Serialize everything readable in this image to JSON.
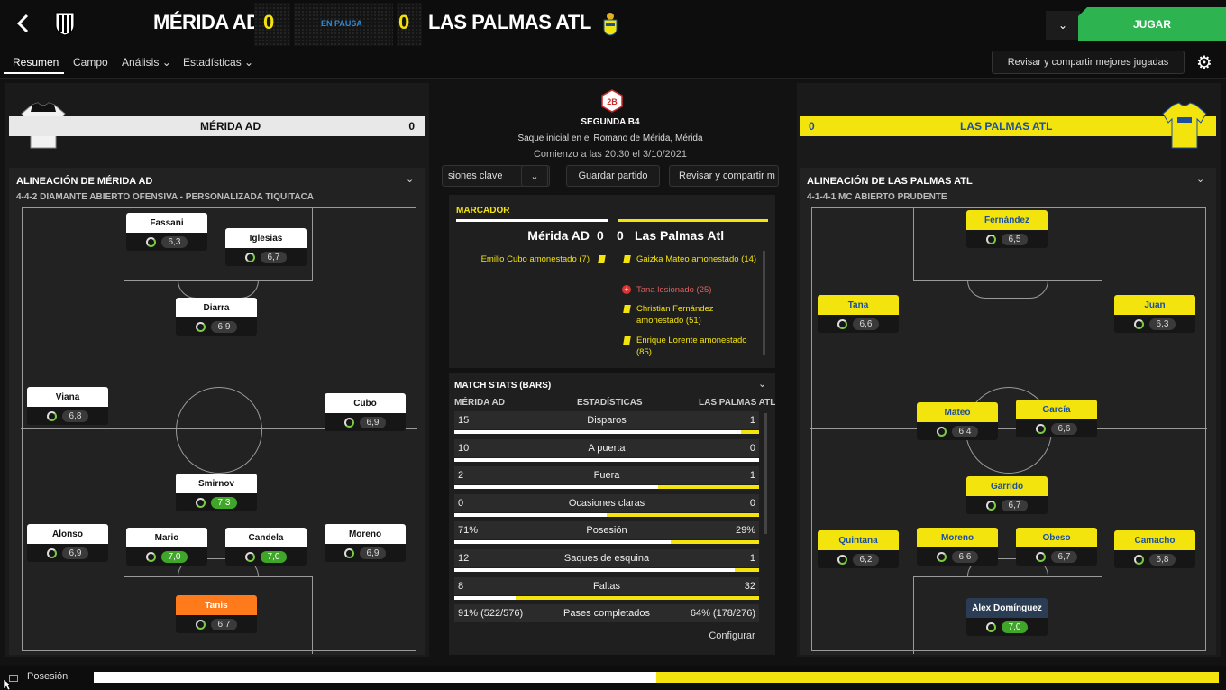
{
  "header": {
    "home_team": "MÉRIDA AD",
    "away_team": "LAS PALMAS ATL",
    "home_score": "0",
    "away_score": "0",
    "status": "EN PAUSA",
    "play_label": "JUGAR",
    "accent_green": "#2db350",
    "accent_yellow": "#f4e40d"
  },
  "nav": {
    "tabs": [
      "Resumen",
      "Campo",
      "Análisis",
      "Estadísticas"
    ],
    "share_label": "Revisar y compartir mejores jugadas"
  },
  "home_panel": {
    "team": "MÉRIDA AD",
    "score": "0",
    "lineup_title": "ALINEACIÓN DE MÉRIDA AD",
    "formation": "4-4-2 DIAMANTE ABIERTO OFENSIVA - PERSONALIZADA TIQUITACA",
    "players": [
      {
        "name": "Fassani",
        "rating": "6,3",
        "style": "white"
      },
      {
        "name": "Iglesias",
        "rating": "6,7",
        "style": "white"
      },
      {
        "name": "Diarra",
        "rating": "6,9",
        "style": "white"
      },
      {
        "name": "Viana",
        "rating": "6,8",
        "style": "white"
      },
      {
        "name": "Cubo",
        "rating": "6,9",
        "style": "white"
      },
      {
        "name": "Smirnov",
        "rating": "7,3",
        "style": "white",
        "high": true
      },
      {
        "name": "Alonso",
        "rating": "6,9",
        "style": "white"
      },
      {
        "name": "Mario",
        "rating": "7,0",
        "style": "white",
        "high": true
      },
      {
        "name": "Candela",
        "rating": "7,0",
        "style": "white",
        "high": true
      },
      {
        "name": "Moreno",
        "rating": "6,9",
        "style": "white"
      },
      {
        "name": "Tanis",
        "rating": "6,7",
        "style": "orange"
      }
    ]
  },
  "away_panel": {
    "team": "LAS PALMAS ATL",
    "score": "0",
    "lineup_title": "ALINEACIÓN DE LAS PALMAS ATL",
    "formation": "4-1-4-1 MC ABIERTO PRUDENTE",
    "players": [
      {
        "name": "Fernández",
        "rating": "6,5",
        "style": "yel"
      },
      {
        "name": "Tana",
        "rating": "6,6",
        "style": "yel"
      },
      {
        "name": "Juan",
        "rating": "6,3",
        "style": "yel"
      },
      {
        "name": "Mateo",
        "rating": "6,4",
        "style": "yel"
      },
      {
        "name": "García",
        "rating": "6,6",
        "style": "yel"
      },
      {
        "name": "Garrido",
        "rating": "6,7",
        "style": "yel"
      },
      {
        "name": "Quintana",
        "rating": "6,2",
        "style": "yel"
      },
      {
        "name": "Moreno",
        "rating": "6,6",
        "style": "yel"
      },
      {
        "name": "Obeso",
        "rating": "6,7",
        "style": "yel"
      },
      {
        "name": "Camacho",
        "rating": "6,8",
        "style": "yel"
      },
      {
        "name": "Álex Domínguez",
        "rating": "7,0",
        "style": "dark",
        "high": true
      }
    ]
  },
  "match_info": {
    "competition": "SEGUNDA B4",
    "venue": "Saque inicial en el Romano de Mérida, Mérida",
    "kickoff": "Comienzo a las 20:30 el 3/10/2021",
    "btn_ocasiones": "siones clave",
    "btn_guardar": "Guardar partido",
    "btn_revisar": "Revisar y compartir m"
  },
  "marcador": {
    "title": "MARCADOR",
    "home": "Mérida AD",
    "home_score": "0",
    "away_score": "0",
    "away": "Las Palmas Atl",
    "home_events": [
      "Emilio Cubo amonestado (7)"
    ],
    "away_events": [
      {
        "text": "Gaizka Mateo amonestado (14)",
        "type": "yellow"
      },
      {
        "text": "Tana lesionado (25)",
        "type": "injury"
      },
      {
        "text": "Christian Fernández amonestado (51)",
        "type": "yellow"
      },
      {
        "text": "Enrique Lorente amonestado (85)",
        "type": "yellow"
      }
    ]
  },
  "stats": {
    "title": "MATCH STATS (BARS)",
    "col_home": "MÉRIDA AD",
    "col_mid": "ESTADÍSTICAS",
    "col_away": "LAS PALMAS ATL",
    "rows": [
      {
        "label": "Disparos",
        "home": "15",
        "away": "1",
        "home_frac": 0.94
      },
      {
        "label": "A puerta",
        "home": "10",
        "away": "0",
        "home_frac": 1.0
      },
      {
        "label": "Fuera",
        "home": "2",
        "away": "1",
        "home_frac": 0.67
      },
      {
        "label": "Ocasiones claras",
        "home": "0",
        "away": "0",
        "home_frac": 0.5
      },
      {
        "label": "Posesión",
        "home": "71%",
        "away": "29%",
        "home_frac": 0.71
      },
      {
        "label": "Saques de esquina",
        "home": "12",
        "away": "1",
        "home_frac": 0.92
      },
      {
        "label": "Faltas",
        "home": "8",
        "away": "32",
        "home_frac": 0.2
      },
      {
        "label": "Pases completados",
        "home": "91% (522/576)",
        "away": "64% (178/276)"
      }
    ],
    "configure": "Configurar"
  },
  "bottom": {
    "label": "Posesión",
    "home_frac": 0.5
  }
}
